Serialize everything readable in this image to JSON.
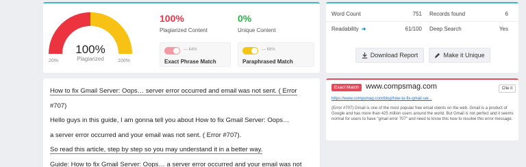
{
  "summary": {
    "gauge": {
      "percent_label": "100%",
      "sub_label": "Plagiarized",
      "min_label": "20%",
      "max_label": "100%",
      "value_fraction": 1.0
    },
    "plagiarized": {
      "value": "100%",
      "label": "Plagiarized Content",
      "color": "#e8334a"
    },
    "unique": {
      "value": "0%",
      "label": "Unique Content",
      "color": "#2bb34a"
    },
    "exact_phrase": {
      "label": "Exact Phrase Match",
      "value": "— 64%",
      "color": "#f29aa5"
    },
    "paraphrased": {
      "label": "Paraphrased Match",
      "value": "— 68%",
      "color": "#f5c518"
    }
  },
  "stats": {
    "word_count": {
      "label": "Word Count",
      "value": "751"
    },
    "records_found": {
      "label": "Records found",
      "value": "6"
    },
    "readability": {
      "label": "Readability",
      "value": "61/100"
    },
    "deep_search": {
      "label": "Deep Search",
      "value": "Yes"
    },
    "download_label": "Download Report",
    "unique_label": "Make it Unique"
  },
  "document": {
    "lines": [
      "How to fix Gmail Server: Oops… server error occurred and email was not sent. ( Error",
      "#707)",
      "Hello guys in this guide, I am gonna tell you about How to fix Gmail Server: Oops…",
      "a server error occurred and your email was not sent. ( Error #707).",
      "So read this article, step by step so you may understand it in a better way.",
      "Guide: How to fix Gmail Server: Oops… a server error occurred and your email was not"
    ]
  },
  "match": {
    "badge": "Exact Match",
    "site": "www.compsmag.com",
    "cite_label": "Cite it",
    "url": "https://www.compsmag.com/blog/how-to-fix-gmail-ser...",
    "snippet": "(Error #707) Gmail is one of the most popular free email clients on the web. Gmail is a product of Google and has more than 425 million users around the world. But Gmail is not perfect and it seems normal for users to have \"gmail error 707\" and need to know this how to resolve this error message."
  },
  "colors": {
    "accent": "#3fb8c4",
    "danger": "#e34b5a",
    "gauge_red": "#ec3340",
    "gauge_yellow": "#f7c214"
  }
}
